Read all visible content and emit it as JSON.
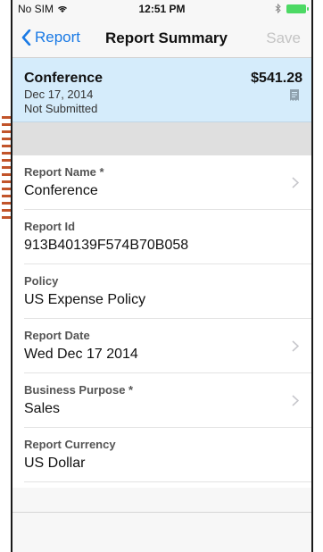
{
  "status_bar": {
    "carrier": "No SIM",
    "time": "12:51 PM"
  },
  "nav": {
    "back_label": "Report",
    "title": "Report Summary",
    "save_label": "Save"
  },
  "summary": {
    "name": "Conference",
    "date": "Dec 17, 2014",
    "status": "Not Submitted",
    "amount": "$541.28"
  },
  "fields": [
    {
      "label": "Report Name *",
      "value": "Conference"
    },
    {
      "label": "Report Id",
      "value": "913B40139F574B70B058"
    },
    {
      "label": "Policy",
      "value": "US Expense Policy"
    },
    {
      "label": "Report Date",
      "value": "Wed Dec 17 2014"
    },
    {
      "label": "Business Purpose *",
      "value": "Sales"
    },
    {
      "label": "Report Currency",
      "value": "US  Dollar"
    }
  ],
  "colors": {
    "accent": "#1a7ae5",
    "summary_bg": "#d5ecfb",
    "battery": "#4cd964",
    "stitch": "#c2542a"
  }
}
